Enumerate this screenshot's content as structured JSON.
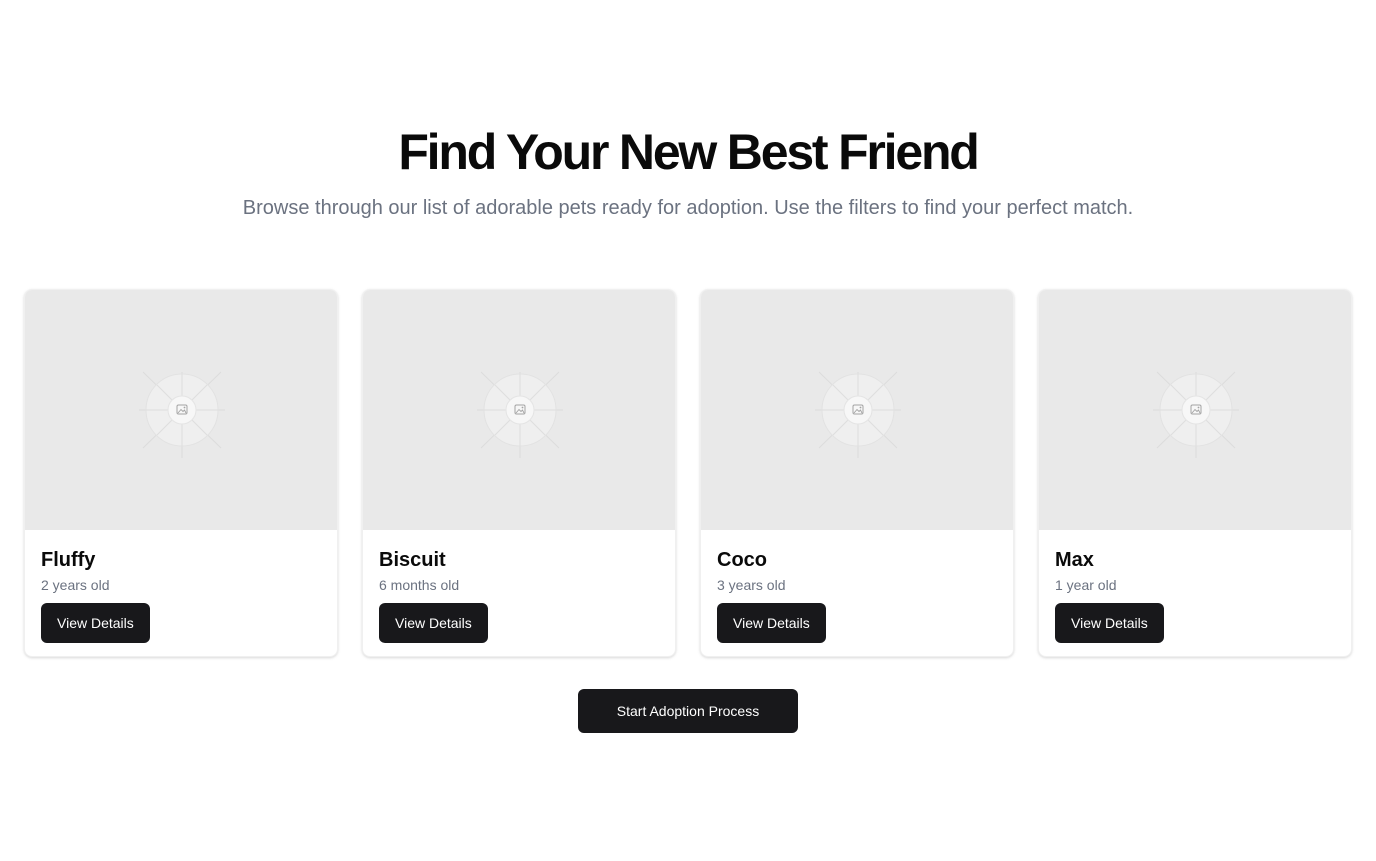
{
  "hero": {
    "title": "Find Your New Best Friend",
    "subtitle": "Browse through our list of adorable pets ready for adoption. Use the filters to find your perfect match."
  },
  "pets": [
    {
      "name": "Fluffy",
      "age": "2 years old",
      "button_label": "View Details",
      "image_icon": "image-placeholder-icon"
    },
    {
      "name": "Biscuit",
      "age": "6 months old",
      "button_label": "View Details",
      "image_icon": "image-placeholder-icon"
    },
    {
      "name": "Coco",
      "age": "3 years old",
      "button_label": "View Details",
      "image_icon": "image-placeholder-icon"
    },
    {
      "name": "Max",
      "age": "1 year old",
      "button_label": "View Details",
      "image_icon": "image-placeholder-icon"
    }
  ],
  "cta": {
    "label": "Start Adoption Process"
  },
  "colors": {
    "primary_button": "#18181b",
    "muted_text": "#6b7280",
    "placeholder_bg": "#e9e9e9"
  }
}
